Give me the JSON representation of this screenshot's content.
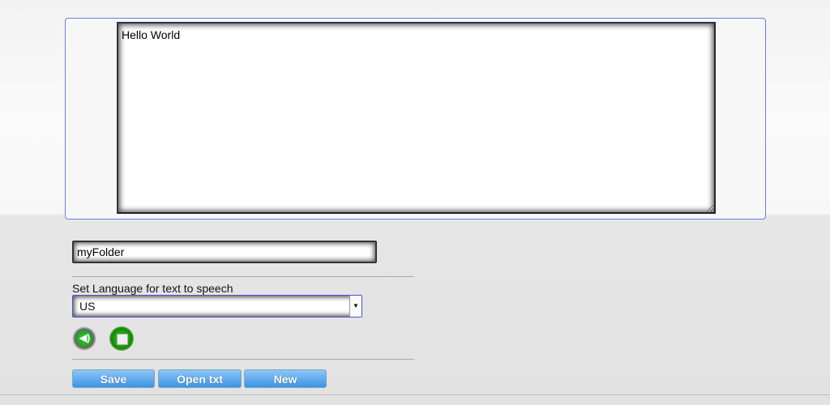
{
  "editor": {
    "text": "Hello World"
  },
  "folder": {
    "value": "myFolder"
  },
  "language": {
    "label": "Set Language for text to speech",
    "selected": "US"
  },
  "icons": {
    "speak": "speaker-icon",
    "stop": "stop-icon"
  },
  "buttons": {
    "save": "Save",
    "open": "Open txt",
    "new": "New"
  }
}
